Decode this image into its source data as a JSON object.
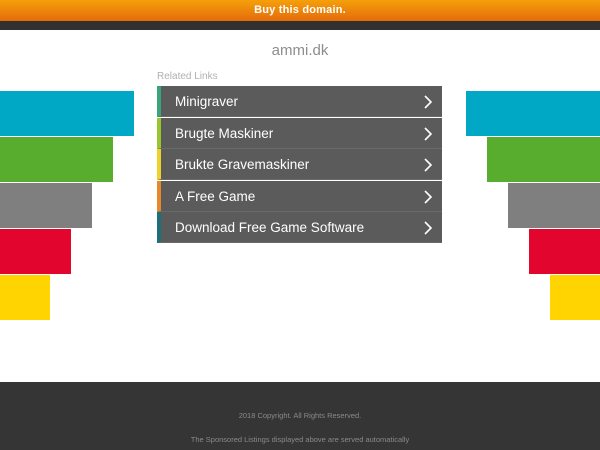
{
  "topbar": {
    "label": "Buy this domain.",
    "color_top": "#f5a00a",
    "color_bottom": "#e46b0a"
  },
  "header": {
    "domain": "ammi.dk"
  },
  "related": {
    "title": "Related Links",
    "items": [
      {
        "label": "Minigraver",
        "accent": "#3aa57a"
      },
      {
        "label": "Brugte Maskiner",
        "accent": "#9ac531"
      },
      {
        "label": "Brukte Gravemaskiner",
        "accent": "#f0d12a"
      },
      {
        "label": "A Free Game",
        "accent": "#e5892a"
      },
      {
        "label": "Download Free Game Software",
        "accent": "#1e6f7a"
      }
    ]
  },
  "decor": {
    "colors": [
      "#00a8c6",
      "#58ad2e",
      "#7f7f7f",
      "#e2062f",
      "#ffd400"
    ]
  },
  "footer": {
    "copyright": "2018 Copyright. All Rights Reserved.",
    "notice": "The Sponsored Listings displayed above are served automatically"
  }
}
